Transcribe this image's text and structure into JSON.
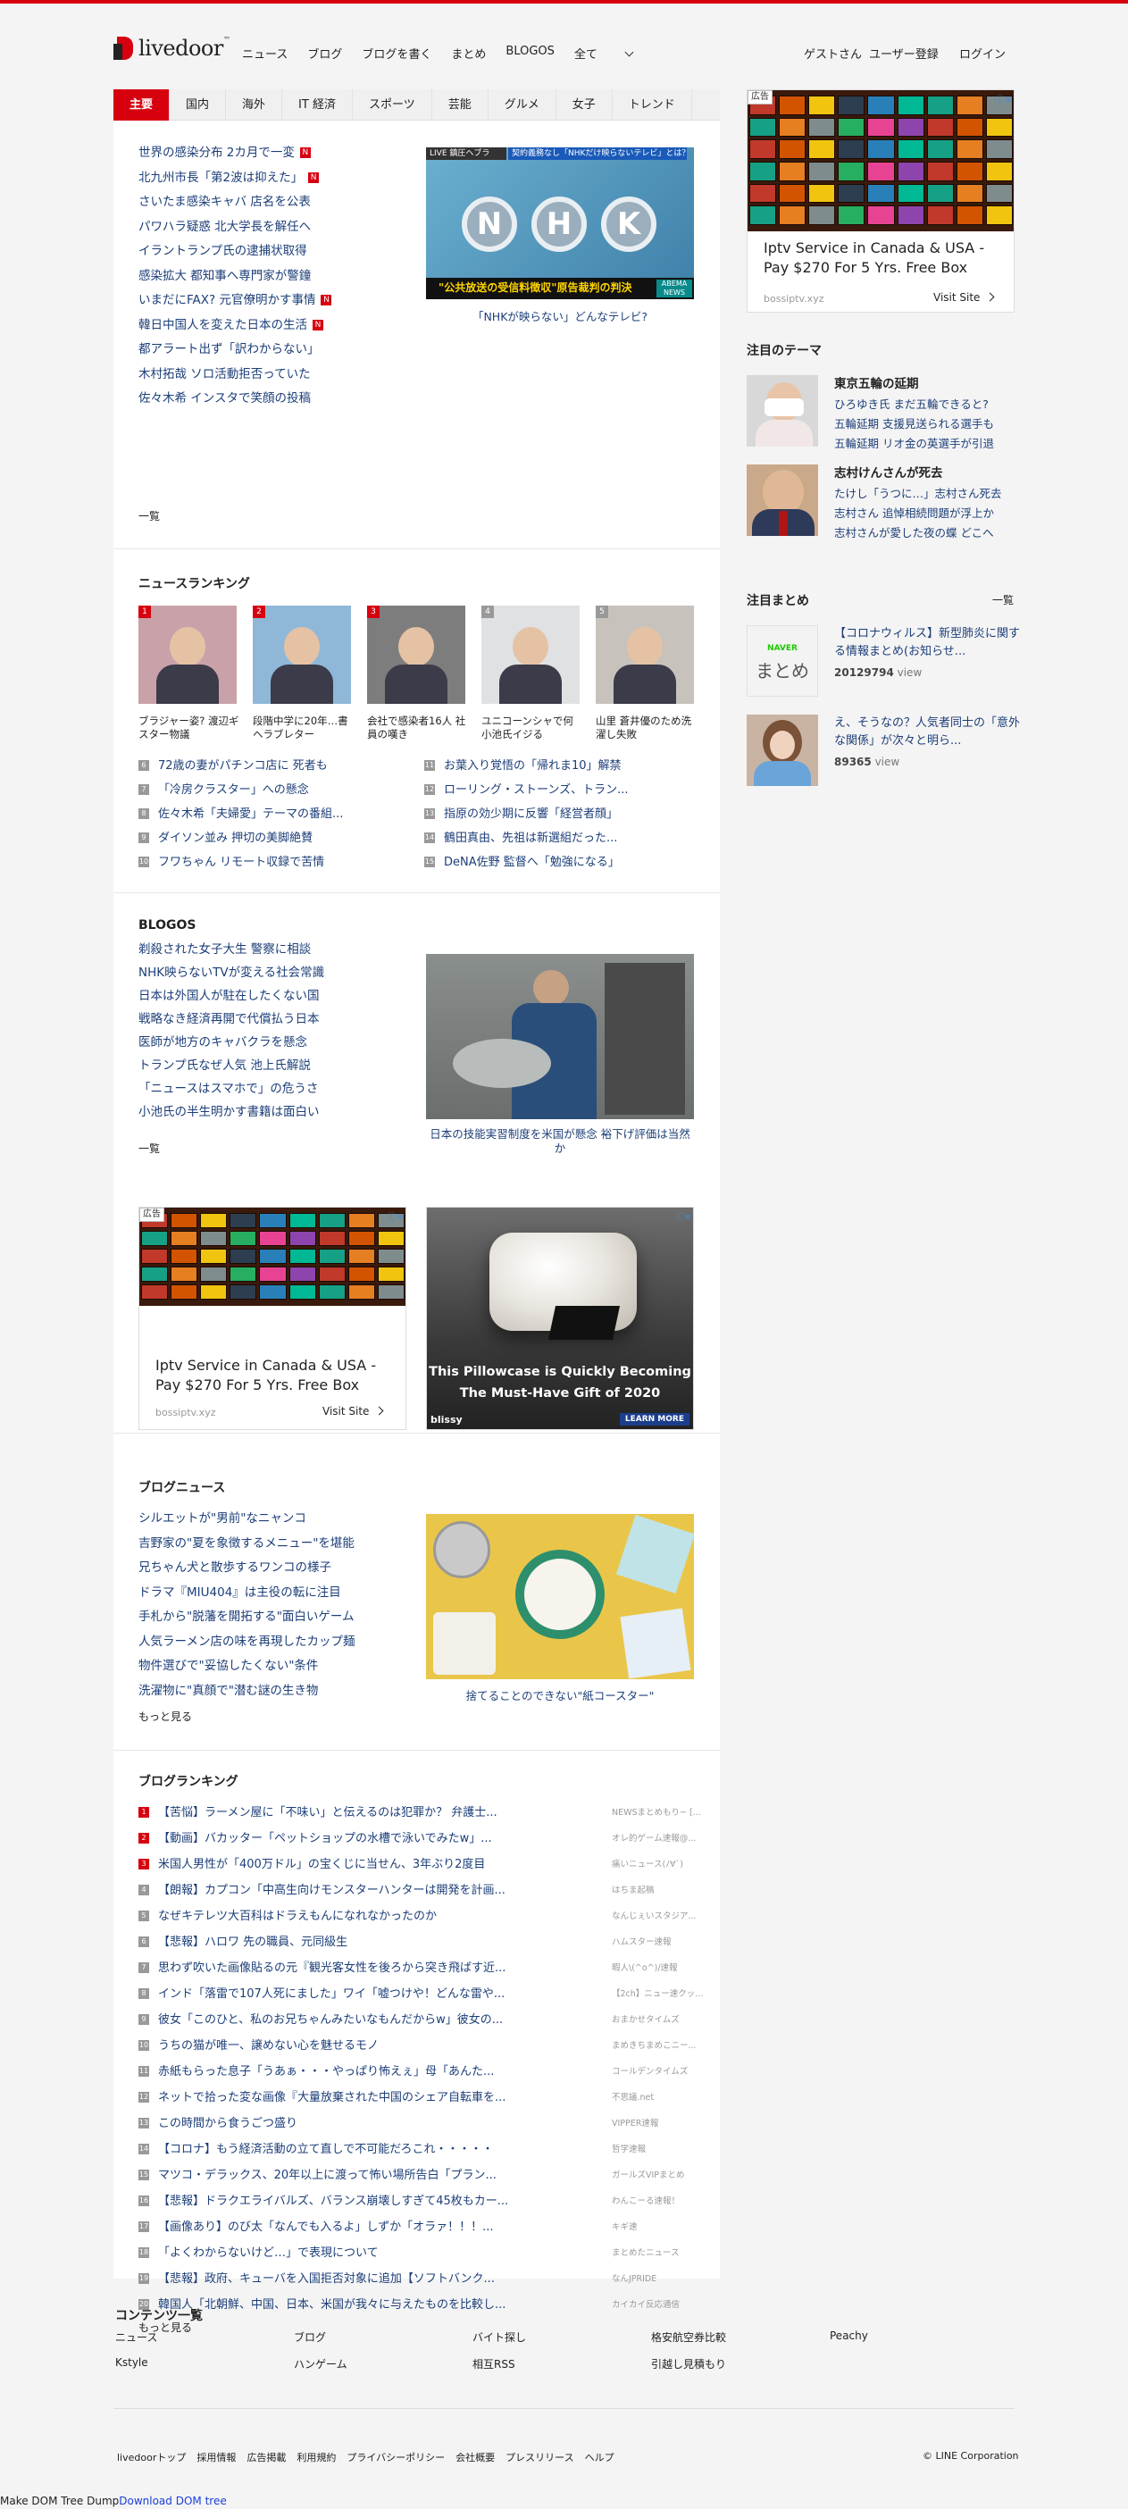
{
  "header": {
    "logo_text": "livedoor",
    "logo_tm": "™",
    "nav_left": [
      "ニュース",
      "ブログ",
      "ブログを書く",
      "まとめ",
      "BLOGOS",
      "全て"
    ],
    "nav_right": [
      "ゲストさん",
      "ユーザー登録",
      "ログイン"
    ]
  },
  "tabs": [
    "主要",
    "国内",
    "海外",
    "IT 経済",
    "スポーツ",
    "芸能",
    "グルメ",
    "女子",
    "トレンド"
  ],
  "top_news": {
    "items": [
      {
        "text": "世界の感染分布 2カ月で一変",
        "new": true
      },
      {
        "text": "北九州市長「第2波は抑えた」",
        "new": true
      },
      {
        "text": "さいたま感染キャバ 店名を公表",
        "new": false
      },
      {
        "text": "パワハラ疑惑 北大学長を解任へ",
        "new": false
      },
      {
        "text": "イラントランプ氏の逮捕状取得",
        "new": false
      },
      {
        "text": "感染拡大 都知事へ専門家が警鐘",
        "new": false
      },
      {
        "text": "いまだにFAX? 元官僚明かす事情",
        "new": true
      },
      {
        "text": "韓日中国人を変えた日本の生活",
        "new": true
      },
      {
        "text": "都アラート出ず「訳わからない」",
        "new": false
      },
      {
        "text": "木村拓哉 ソロ活動拒否っていた",
        "new": false
      },
      {
        "text": "佐々木希 インスタで笑顔の投稿",
        "new": false
      }
    ],
    "new_label": "N",
    "more": "一覧",
    "photo": {
      "top_left": "LIVE 鎮圧ヘブラ",
      "top_right": "契約義務なし「NHKだけ映らないテレビ」とは？",
      "logo_letters": [
        "N",
        "H",
        "K"
      ],
      "banner": "\"公共放送の受信料徴収\"原告裁判の判決",
      "corner": "ABEMA NEWS",
      "caption": "「NHKが映らない」どんなテレビ?"
    }
  },
  "news_ranking": {
    "title": "ニュースランキング",
    "top5": [
      {
        "rank": "1",
        "caption": "ブラジャー姿? 渡辺ギスター物議"
      },
      {
        "rank": "2",
        "caption": "段階中学に20年…書ヘラブレター"
      },
      {
        "rank": "3",
        "caption": "会社で感染者16人 社員の嘆き"
      },
      {
        "rank": "4",
        "caption": "ユニコーンシャで何 小池氏イジる"
      },
      {
        "rank": "5",
        "caption": "山里 蒼井優のため洗濯し失敗"
      }
    ],
    "col_left": [
      {
        "rank": "6",
        "text": "72歳の妻がパチンコ店に 死者も"
      },
      {
        "rank": "7",
        "text": "「冷房クラスター」への懸念"
      },
      {
        "rank": "8",
        "text": "佐々木希「夫婦愛」テーマの番組..."
      },
      {
        "rank": "9",
        "text": "ダイソン並み 押切の美脚絶賛"
      },
      {
        "rank": "10",
        "text": "フワちゃん リモート収録で苦情"
      }
    ],
    "col_right": [
      {
        "rank": "11",
        "text": "お葉入り覚悟の「帰れま10」解禁"
      },
      {
        "rank": "12",
        "text": "ローリング・ストーンズ、トラン..."
      },
      {
        "rank": "13",
        "text": "指原の効少期に反響「経営者顔」"
      },
      {
        "rank": "14",
        "text": "鶴田真由、先祖は新選組だった..."
      },
      {
        "rank": "15",
        "text": "DeNA佐野 監督へ「勉強になる」"
      }
    ]
  },
  "blogos": {
    "title": "BLOGOS",
    "items": [
      "剃殺された女子大生 警察に相談",
      "NHK映らないTVが変える社会常識",
      "日本は外国人が駐在したくない国",
      "戦略なき経済再開で代償払う日本",
      "医師が地方のキャバクラを懸念",
      "トランプ氏なぜ人気 池上氏解説",
      "「ニュースはスマホで」の危うさ",
      "小池氏の半生明かす書籍は面白い"
    ],
    "more": "一覧",
    "caption": "日本の技能実習制度を米国が懸念 裕下げ評価は当然か"
  },
  "ads": {
    "label": "広告",
    "adx": "ⓘ✕",
    "iptv_title": "Iptv Service in Canada & USA - Pay $270 For 5 Yrs. Free Box",
    "iptv_url": "bossiptv.xyz",
    "visit": "Visit Site",
    "pillow_text": "This Pillowcase is Quickly Becoming The Must-Have Gift of 2020",
    "pillow_brand": "blissy",
    "pillow_btn": "LEARN MORE"
  },
  "blog_news": {
    "title": "ブログニュース",
    "items": [
      "シルエットが\"男前\"なニャンコ",
      "吉野家の\"夏を象徴するメニュー\"を堪能",
      "兄ちゃん犬と散歩するワンコの様子",
      "ドラマ『MIU404』は主役の転に注目",
      "手札から\"脱藩を開拓する\"面白いゲーム",
      "人気ラーメン店の味を再現したカップ麺",
      "物件選びで\"妥協したくない\"条件",
      "洗濯物に\"真顔で\"潜む謎の生き物"
    ],
    "more": "もっと見る",
    "caption": "捨てることのできない\"紙コースター\""
  },
  "blog_ranking": {
    "title": "ブログランキング",
    "items": [
      {
        "rank": "1",
        "text": "【苦悩】ラーメン屋に「不味い」と伝えるのは犯罪か？ 弁護士...",
        "src": "NEWSまとめもり~ [..."
      },
      {
        "rank": "2",
        "text": "【動画】バカッター「ペットショップの水槽で泳いでみたw」...",
        "src": "オレ的ゲーム速報@..."
      },
      {
        "rank": "3",
        "text": "米国人男性が「400万ドル」の宝くじに当せん、3年ぶり2度目",
        "src": "痛いニュース(ﾉ∀`)"
      },
      {
        "rank": "4",
        "text": "【朗報】カプコン「中高生向けモンスターハンターは開発を計画...",
        "src": "はちま起稿"
      },
      {
        "rank": "5",
        "text": "なぜキテレツ大百科はドラえもんになれなかったのか",
        "src": "なんじぇいスタジア..."
      },
      {
        "rank": "6",
        "text": "【悲報】ハロワ 先の職員、元同級生",
        "src": "ハムスター速報"
      },
      {
        "rank": "7",
        "text": "思わず吹いた画像貼るの元『観光客女性を後ろから突き飛ばす近...",
        "src": "暇人\\(^o^)/速報"
      },
      {
        "rank": "8",
        "text": "インド「落雷で107人死にました」ワイ「嘘つけや！どんな雷や...",
        "src": "【2ch】ニュー速クッ..."
      },
      {
        "rank": "9",
        "text": "彼女「このひと、私のお兄ちゃんみたいなもんだからw」彼女の...",
        "src": "おまかせタイムズ"
      },
      {
        "rank": "10",
        "text": "うちの猫が唯一、譲めない心を魅せるモノ",
        "src": "まめきちまめこニー..."
      },
      {
        "rank": "11",
        "text": "赤紙もらった息子「うあぁ・・・やっぱり怖えぇ」母「あんた...",
        "src": "コールデンタイムズ"
      },
      {
        "rank": "12",
        "text": "ネットで拾った変な画像『大量放棄された中国のシェア自転車を...",
        "src": "不思議.net"
      },
      {
        "rank": "13",
        "text": "この時間から食うごつ盛り",
        "src": "VIPPER速報"
      },
      {
        "rank": "14",
        "text": "【コロナ】もう経済活動の立て直しで不可能だろこれ・・・・・",
        "src": "哲学速報"
      },
      {
        "rank": "15",
        "text": "マツコ・デラックス、20年以上に渡って怖い場所告白「プラン...",
        "src": "ガールズVIPまとめ"
      },
      {
        "rank": "16",
        "text": "【悲報】ドラクエライバルズ、バランス崩壊しすぎて45枚もカー...",
        "src": "わんこーる速報！"
      },
      {
        "rank": "17",
        "text": "【画像あり】のび太「なんでも入るよ」しずか「オラァ！！！...",
        "src": "キギ速"
      },
      {
        "rank": "18",
        "text": "「よくわからないけど…」で表現について",
        "src": "まとめたニュース"
      },
      {
        "rank": "19",
        "text": "【悲報】政府、キューバを入国拒否対象に追加【ソフトバンク...",
        "src": "なんJPRIDE"
      },
      {
        "rank": "20",
        "text": "韓国人「北朝鮮、中国、日本、米国が我々に与えたものを比較し...",
        "src": "カイカイ反応通信"
      }
    ],
    "more": "もっと見る"
  },
  "sidebar": {
    "ad_title": "Iptv Service in Canada & USA - Pay $270 For 5 Yrs. Free Box",
    "ad_url": "bossiptv.xyz",
    "ad_visit": "Visit Site",
    "themes_title": "注目のテーマ",
    "themes": [
      {
        "head": "東京五輪の延期",
        "lines": [
          "ひろゆき氏 まだ五輪できると?",
          "五輪延期 支援見送られる選手も",
          "五輪延期 リオ金の英選手が引退"
        ]
      },
      {
        "head": "志村けんさんが死去",
        "lines": [
          "たけし「うつに…」志村さん死去",
          "志村さん 追悼相続問題が浮上か",
          "志村さんが愛した夜の蝶 どこへ"
        ]
      }
    ],
    "matome_title": "注目まとめ",
    "matome_more": "一覧",
    "matome": [
      {
        "text": "【コロナウィルス】新型肺炎に関する情報まとめ(お知らせ...",
        "views": "20129794",
        "unit": "view",
        "thumb_brand": "NAVER",
        "thumb_text": "まとめ"
      },
      {
        "text": "え、そうなの？人気者同士の「意外な関係」が次々と明ら...",
        "views": "89365",
        "unit": "view"
      }
    ]
  },
  "footer": {
    "title": "コンテンツ一覧",
    "grid": [
      [
        "ニュース",
        "ブログ",
        "バイト探し",
        "格安航空券比較",
        "Peachy"
      ],
      [
        "Kstyle",
        "ハンゲーム",
        "相互RSS",
        "引越し見積もり"
      ]
    ],
    "links": [
      "livedoorトップ",
      "採用情報",
      "広告掲載",
      "利用規約",
      "プライバシーポリシー",
      "会社概要",
      "プレスリリース",
      "ヘルプ"
    ],
    "copyright": "© LINE Corporation",
    "dom_left": "Make DOM Tree Dump",
    "dom_link": "Download DOM tree"
  }
}
